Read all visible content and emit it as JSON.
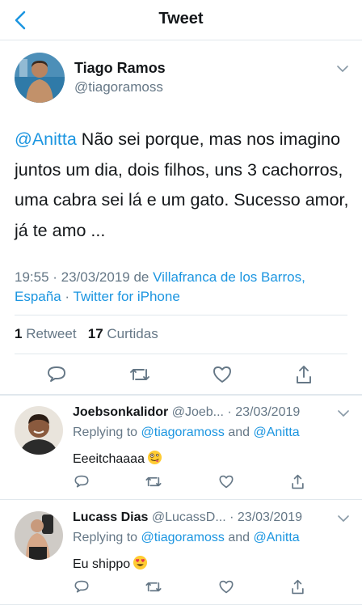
{
  "header": {
    "title": "Tweet",
    "back_icon": "chevron-left-icon",
    "accent": "#1b95e0"
  },
  "tweet": {
    "name": "Tiago Ramos",
    "handle": "@tiagoramoss",
    "mention": "@Anitta",
    "text": " Não sei porque, mas nos imagino juntos um dia, dois filhos, uns 3 cachorros, uma cabra sei lá e um gato. Sucesso amor, já te amo ...",
    "time": "19:55 · 23/03/2019",
    "from": "de",
    "location": "Villafranca de los Barros, España",
    "dot": "·",
    "client": "Twitter for iPhone",
    "retweets_count": "1",
    "retweets_label": "Retweet",
    "likes_count": "17",
    "likes_label": "Curtidas"
  },
  "replies": [
    {
      "name": "Joebsonkalidor",
      "handle_date": "@Joeb... · 23/03/2019",
      "replying_label": "Replying to",
      "to1": "@tiagoramoss",
      "and": "and",
      "to2": "@Anitta",
      "text": "Eeeitchaaaa",
      "emoji": "zany-face-emoji"
    },
    {
      "name": "Lucass Dias",
      "handle_date": "@LucassD... · 23/03/2019",
      "replying_label": "Replying to",
      "to1": "@tiagoramoss",
      "and": "and",
      "to2": "@Anitta",
      "text": "Eu shippo",
      "emoji": "heart-eyes-emoji"
    }
  ]
}
